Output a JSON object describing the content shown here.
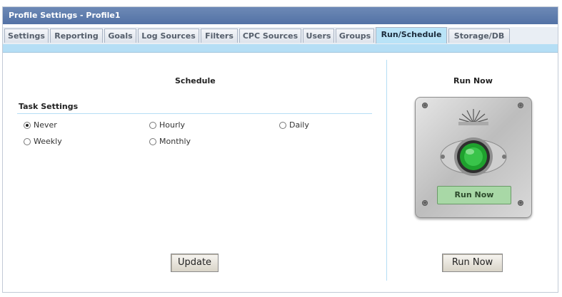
{
  "window": {
    "title": "Profile Settings - Profile1"
  },
  "tabs": [
    {
      "label": "Settings"
    },
    {
      "label": "Reporting"
    },
    {
      "label": "Goals"
    },
    {
      "label": "Log Sources"
    },
    {
      "label": "Filters"
    },
    {
      "label": "CPC Sources"
    },
    {
      "label": "Users"
    },
    {
      "label": "Groups"
    },
    {
      "label": "Run/Schedule",
      "active": true
    },
    {
      "label": "Storage/DB"
    }
  ],
  "schedule": {
    "heading": "Schedule",
    "task_settings_label": "Task Settings",
    "options": [
      {
        "label": "Never",
        "selected": true
      },
      {
        "label": "Hourly",
        "selected": false
      },
      {
        "label": "Daily",
        "selected": false
      },
      {
        "label": "Weekly",
        "selected": false
      },
      {
        "label": "Monthly",
        "selected": false
      }
    ],
    "update_button": "Update"
  },
  "run_now": {
    "heading": "Run Now",
    "panel_label": "Run Now",
    "button": "Run Now",
    "indicator_color": "#1fa12e"
  }
}
